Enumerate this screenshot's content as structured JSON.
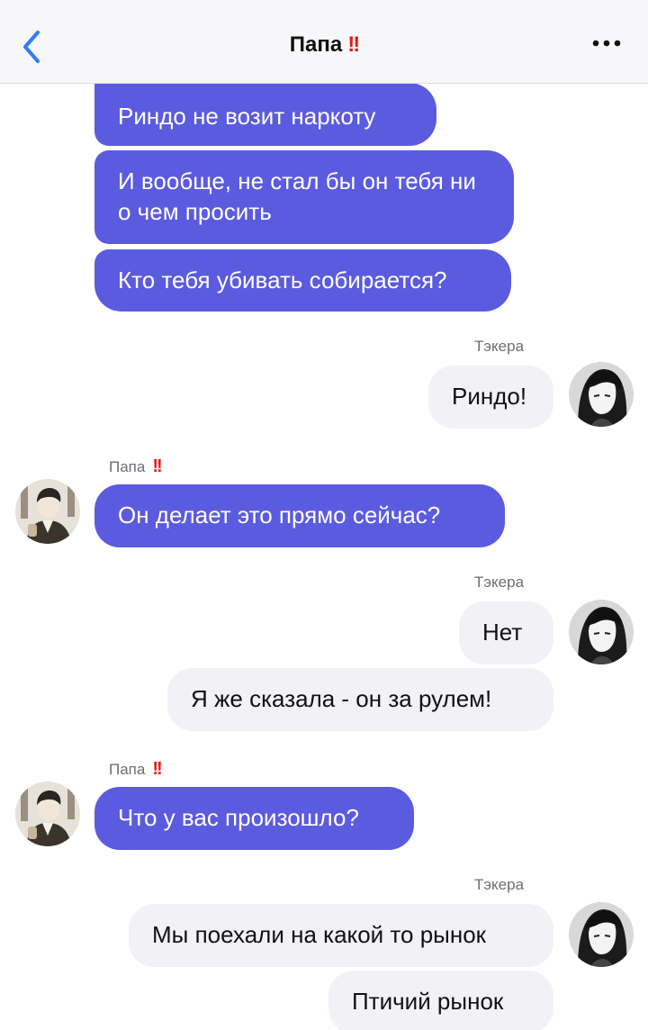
{
  "header": {
    "title": "Папа",
    "title_marks": "!!",
    "back_icon": "chevron-left-icon",
    "more_icon": "ellipsis-icon"
  },
  "colors": {
    "incoming_bubble": "#5b5be0",
    "outgoing_bubble": "#f2f2f6",
    "accent": "#2f7cf6",
    "alert": "#e11d1d"
  },
  "messages": [
    {
      "dir": "in",
      "text": "Риндо не возит наркоту"
    },
    {
      "dir": "in",
      "text": "И вообще, не стал бы он тебя ни о чем просить"
    },
    {
      "dir": "in",
      "text": "Кто тебя убивать собирается?"
    },
    {
      "dir": "out",
      "sender": "Тэкера",
      "text": "Риндо!"
    },
    {
      "dir": "in",
      "sender": "Папа",
      "sender_marks": "!!",
      "text": "Он делает это прямо сейчас?"
    },
    {
      "dir": "out",
      "sender": "Тэкера",
      "text": "Нет"
    },
    {
      "dir": "out",
      "text": "Я же сказала - он за рулем!"
    },
    {
      "dir": "in",
      "sender": "Папа",
      "sender_marks": "!!",
      "text": "Что у вас произошло?"
    },
    {
      "dir": "out",
      "sender": "Тэкера",
      "text": "Мы поехали на какой то рынок"
    },
    {
      "dir": "out",
      "text": "Птичий рынок"
    }
  ]
}
